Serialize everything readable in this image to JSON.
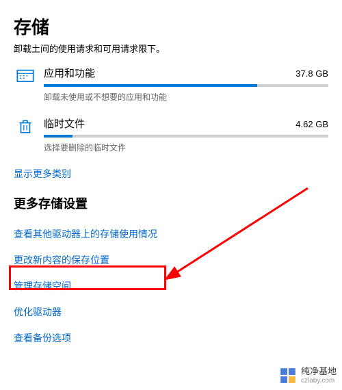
{
  "page_title": "存储",
  "truncated_text": "卸载土间的使用请求和可用请求限下。",
  "storage_items": [
    {
      "name": "应用和功能",
      "size": "37.8 GB",
      "desc": "卸载未使用或不想要的应用和功能",
      "progress": 75
    },
    {
      "name": "临时文件",
      "size": "4.62 GB",
      "desc": "选择要删除的临时文件",
      "progress": 10
    }
  ],
  "show_more": "显示更多类别",
  "section_title": "更多存储设置",
  "links": [
    "查看其他驱动器上的存储使用情况",
    "更改新内容的保存位置",
    "管理存储空间",
    "优化驱动器",
    "查看备份选项"
  ],
  "watermark": {
    "title": "纯净基地",
    "url": "czlaby.com"
  }
}
